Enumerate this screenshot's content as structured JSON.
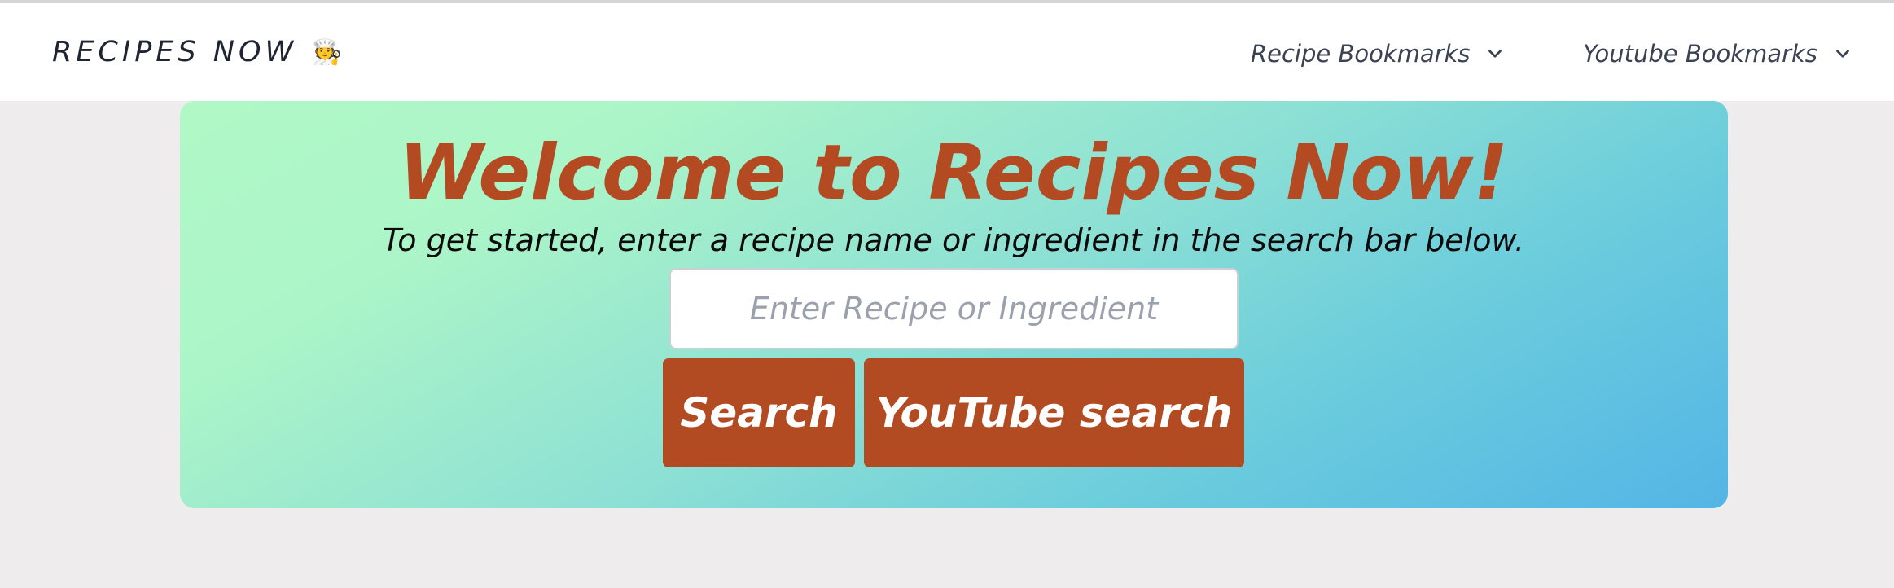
{
  "navbar": {
    "brand": "RECIPES NOW",
    "brand_emoji": "🧑‍🍳",
    "menus": [
      {
        "label": "Recipe Bookmarks",
        "icon": "chevron-down-icon"
      },
      {
        "label": "Youtube Bookmarks",
        "icon": "chevron-down-icon"
      }
    ]
  },
  "hero": {
    "title": "Welcome to Recipes Now!",
    "subtitle": "To get started, enter a recipe name or ingredient in the search bar below.",
    "search": {
      "value": "",
      "placeholder": "Enter Recipe or Ingredient"
    },
    "buttons": {
      "search": "Search",
      "youtube": "YouTube search"
    }
  },
  "colors": {
    "accent": "#b24a22",
    "navbar_bg": "#ffffff",
    "page_bg": "#eeecec",
    "hero_gradient_start": "#b0f8c6",
    "hero_gradient_end": "#54b5e6"
  }
}
